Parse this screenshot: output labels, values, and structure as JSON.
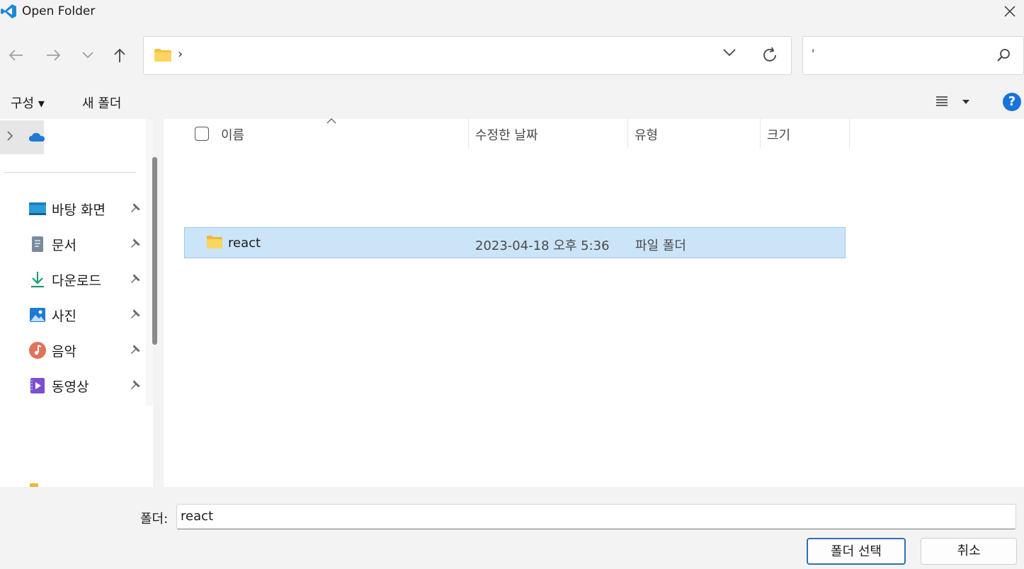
{
  "window": {
    "title": "Open Folder",
    "close_icon": "close-icon"
  },
  "nav": {
    "back_icon": "arrow-left-icon",
    "forward_icon": "arrow-right-icon",
    "recent_icon": "chevron-down-icon",
    "up_icon": "arrow-up-icon",
    "address": {
      "separator": "›"
    },
    "search": {
      "value": "'"
    }
  },
  "toolbar": {
    "organize_label": "구성 ▾",
    "new_folder_label": "새 폴더",
    "help_label": "?"
  },
  "sidebar": {
    "items": [
      {
        "label": "바탕 화면",
        "icon": "desktop-icon"
      },
      {
        "label": "문서",
        "icon": "document-icon"
      },
      {
        "label": "다운로드",
        "icon": "download-icon"
      },
      {
        "label": "사진",
        "icon": "pictures-icon"
      },
      {
        "label": "음악",
        "icon": "music-icon"
      },
      {
        "label": "동영상",
        "icon": "video-icon"
      }
    ]
  },
  "columns": {
    "name": "이름",
    "modified": "수정한 날짜",
    "type": "유형",
    "size": "크기"
  },
  "files": [
    {
      "name": "react",
      "modified": "2023-04-18 오후 5:36",
      "type": "파일 폴더",
      "size": ""
    }
  ],
  "footer": {
    "folder_label": "폴더:",
    "folder_value": "react",
    "select_button": "폴더 선택",
    "cancel_button": "취소"
  },
  "colors": {
    "accent": "#1a73d9",
    "selection": "#cce4f7",
    "chrome": "#f3f3f3"
  }
}
